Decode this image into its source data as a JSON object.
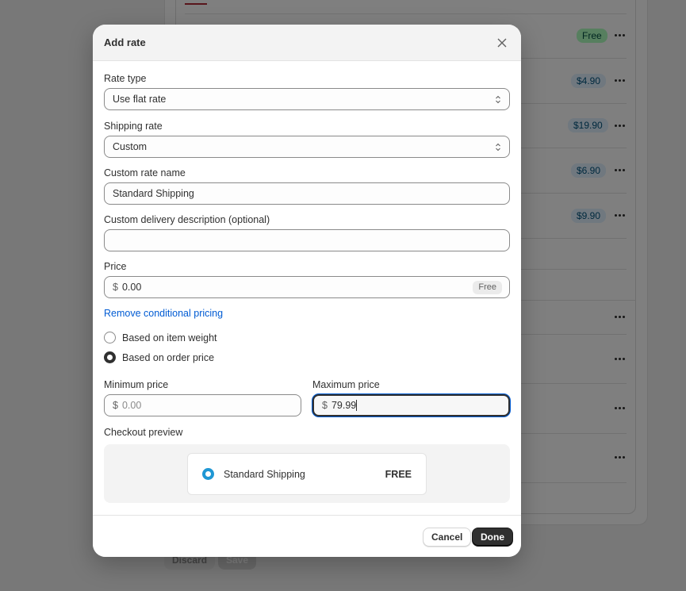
{
  "background": {
    "rate_rows": [
      {
        "badge": "Free",
        "badge_style": "green"
      },
      {
        "badge": "$4.90",
        "badge_style": "blue"
      },
      {
        "badge": "$19.90",
        "badge_style": "blue"
      },
      {
        "badge": "$6.90",
        "badge_style": "blue"
      },
      {
        "badge": "$9.90",
        "badge_style": "blue"
      }
    ],
    "discard_label": "Discard",
    "save_label": "Save"
  },
  "modal": {
    "title": "Add rate",
    "close_icon": "close-icon",
    "rate_type": {
      "label": "Rate type",
      "value": "Use flat rate"
    },
    "shipping_rate": {
      "label": "Shipping rate",
      "value": "Custom"
    },
    "custom_rate_name": {
      "label": "Custom rate name",
      "value": "Standard Shipping"
    },
    "custom_delivery_description": {
      "label": "Custom delivery description (optional)",
      "value": ""
    },
    "price": {
      "label": "Price",
      "prefix": "$",
      "value": "0.00",
      "tag": "Free"
    },
    "remove_conditional_link": "Remove conditional pricing",
    "conditions": [
      {
        "label": "Based on item weight",
        "checked": false
      },
      {
        "label": "Based on order price",
        "checked": true
      }
    ],
    "minimum_price": {
      "label": "Minimum price",
      "prefix": "$",
      "placeholder": "0.00",
      "value": ""
    },
    "maximum_price": {
      "label": "Maximum price",
      "prefix": "$",
      "value": "79.99"
    },
    "checkout_preview": {
      "label": "Checkout preview",
      "name": "Standard Shipping",
      "price": "FREE"
    },
    "footer": {
      "cancel_label": "Cancel",
      "done_label": "Done"
    }
  },
  "colors": {
    "link": "#005bd3",
    "primary_button": "#303030",
    "preview_radio": "#1f97d4",
    "free_badge": "#affebf",
    "price_badge": "#e0f0ff"
  }
}
